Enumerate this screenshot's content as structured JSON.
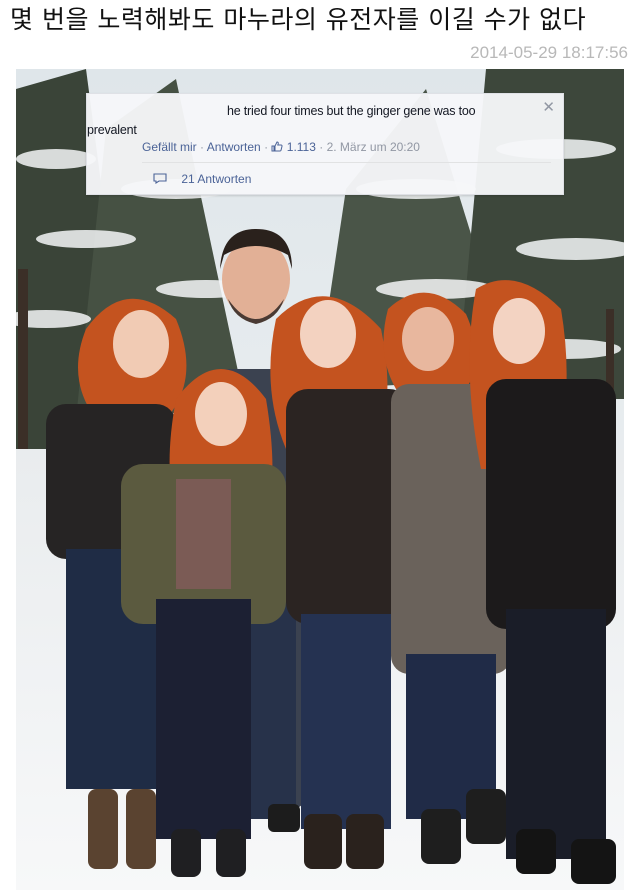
{
  "post": {
    "title": "몇 번을 노력해봐도 마누라의 유전자를 이길 수가 없다",
    "timestamp": "2014-05-29 18:17:56"
  },
  "comment": {
    "text_line1": "he tried four times but the ginger gene was too",
    "text_line2": "prevalent",
    "like_label": "Gefällt mir",
    "sep": "·",
    "reply_label": "Antworten",
    "like_count": "1.113",
    "date": "2. März um 20:20",
    "replies_label": "21 Antworten",
    "close_glyph": "✕"
  },
  "icons": {
    "close": "close-icon",
    "like": "thumbs-up-icon",
    "reply": "speech-bubble-icon"
  },
  "colors": {
    "hair": "#c4531f",
    "link_blue": "#4b6397",
    "muted_grey": "#9197a3",
    "timestamp_grey": "#b8b8b8"
  }
}
